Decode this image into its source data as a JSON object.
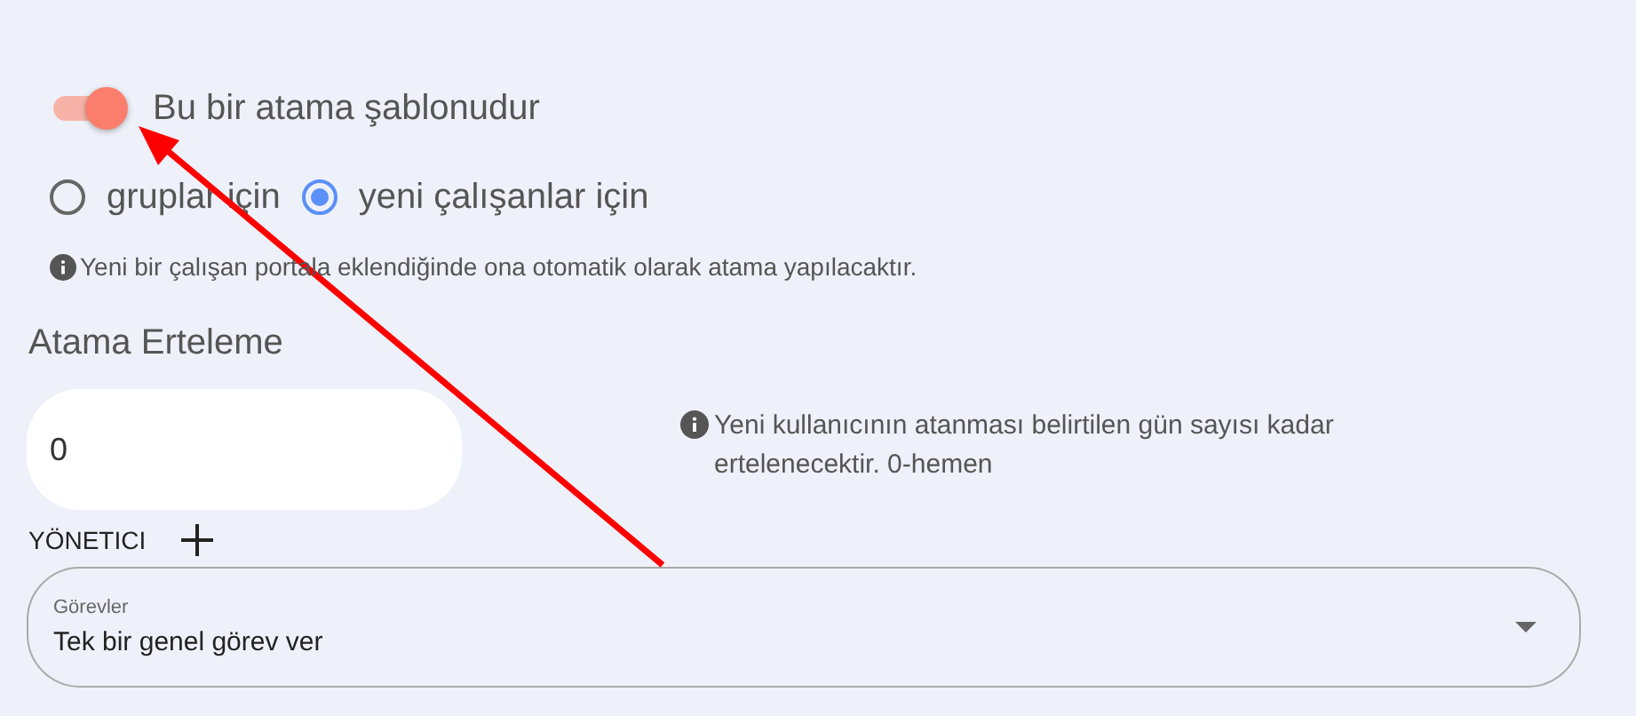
{
  "template_toggle": {
    "label": "Bu bir atama şablonudur",
    "on": true
  },
  "target_options": [
    {
      "label": "gruplar için",
      "selected": false
    },
    {
      "label": "yeni çalışanlar için",
      "selected": true
    }
  ],
  "target_info": "Yeni bir çalışan portala eklendiğinde ona otomatik olarak atama yapılacaktır.",
  "delay": {
    "label": "Atama Erteleme",
    "value": "0",
    "info": "Yeni kullanıcının atanması belirtilen gün sayısı kadar ertelenecektir. 0-hemen"
  },
  "manager": {
    "label": "YÖNETICI"
  },
  "tasks_select": {
    "label": "Görevler",
    "value": "Tek bir genel görev ver"
  }
}
